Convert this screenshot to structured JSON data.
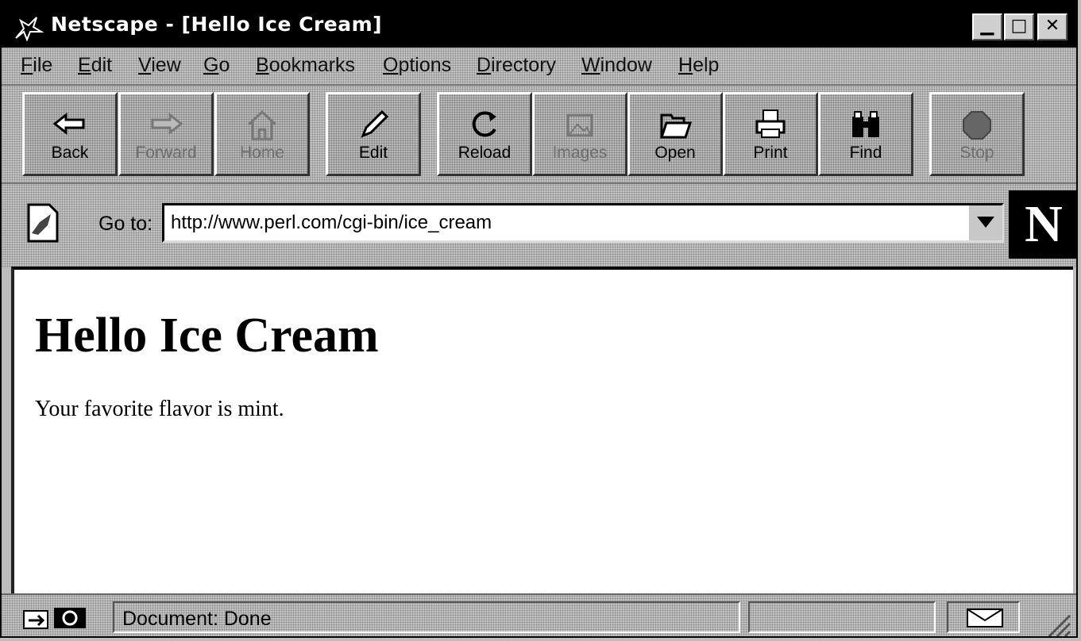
{
  "window": {
    "title": "Netscape - [Hello Ice Cream]",
    "buttons": {
      "minimize": "▁",
      "maximize": "□",
      "close": "✕"
    }
  },
  "menu": {
    "items": [
      "File",
      "Edit",
      "View",
      "Go",
      "Bookmarks",
      "Options",
      "Directory",
      "Window",
      "Help"
    ]
  },
  "toolbar": {
    "buttons": [
      {
        "label": "Back",
        "icon": "back-arrow-icon",
        "enabled": true
      },
      {
        "label": "Forward",
        "icon": "forward-arrow-icon",
        "enabled": false
      },
      {
        "label": "Home",
        "icon": "home-icon",
        "enabled": false
      },
      {
        "label": "Edit",
        "icon": "pencil-icon",
        "enabled": true
      },
      {
        "label": "Reload",
        "icon": "reload-icon",
        "enabled": true
      },
      {
        "label": "Images",
        "icon": "images-icon",
        "enabled": false
      },
      {
        "label": "Open",
        "icon": "open-icon",
        "enabled": true
      },
      {
        "label": "Print",
        "icon": "printer-icon",
        "enabled": true
      },
      {
        "label": "Find",
        "icon": "binoculars-icon",
        "enabled": true
      },
      {
        "label": "Stop",
        "icon": "stop-icon",
        "enabled": false
      }
    ]
  },
  "location": {
    "label": "Go to:",
    "url": "http://www.perl.com/cgi-bin/ice_cream",
    "logo_letter": "N"
  },
  "page": {
    "heading": "Hello Ice Cream",
    "text": "Your favorite flavor is mint."
  },
  "status": {
    "text": "Document: Done"
  },
  "colors": {
    "chrome": "#c0c0c0",
    "titlebar": "#000000",
    "content_bg": "#ffffff"
  }
}
